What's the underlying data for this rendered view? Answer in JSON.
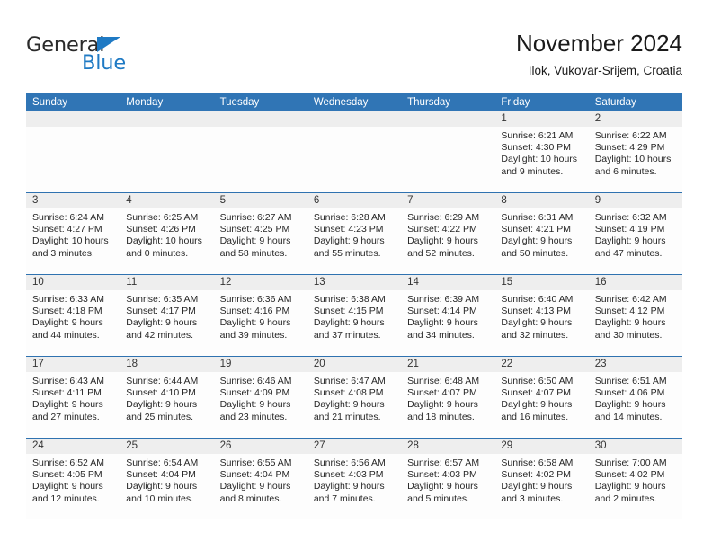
{
  "brand": {
    "word1": "General",
    "word2": "Blue",
    "triangle_color": "#1f7ac4",
    "text_color": "#2b2b2b"
  },
  "header": {
    "title": "November 2024",
    "subtitle": "Ilok, Vukovar-Srijem, Croatia"
  },
  "colors": {
    "header_blue": "#3075b5",
    "row_divider_blue": "#2f72b0",
    "daynum_band": "#eeeeee",
    "cell_background": "#fdfdfd",
    "text": "#262626"
  },
  "weekdays": [
    "Sunday",
    "Monday",
    "Tuesday",
    "Wednesday",
    "Thursday",
    "Friday",
    "Saturday"
  ],
  "weeks": [
    {
      "days": [
        {
          "day": "",
          "empty": true,
          "sunrise": "",
          "sunset": "",
          "daylight_l1": "",
          "daylight_l2": ""
        },
        {
          "day": "",
          "empty": true,
          "sunrise": "",
          "sunset": "",
          "daylight_l1": "",
          "daylight_l2": ""
        },
        {
          "day": "",
          "empty": true,
          "sunrise": "",
          "sunset": "",
          "daylight_l1": "",
          "daylight_l2": ""
        },
        {
          "day": "",
          "empty": true,
          "sunrise": "",
          "sunset": "",
          "daylight_l1": "",
          "daylight_l2": ""
        },
        {
          "day": "",
          "empty": true,
          "sunrise": "",
          "sunset": "",
          "daylight_l1": "",
          "daylight_l2": ""
        },
        {
          "day": "1",
          "empty": false,
          "sunrise": "Sunrise: 6:21 AM",
          "sunset": "Sunset: 4:30 PM",
          "daylight_l1": "Daylight: 10 hours",
          "daylight_l2": "and 9 minutes."
        },
        {
          "day": "2",
          "empty": false,
          "sunrise": "Sunrise: 6:22 AM",
          "sunset": "Sunset: 4:29 PM",
          "daylight_l1": "Daylight: 10 hours",
          "daylight_l2": "and 6 minutes."
        }
      ]
    },
    {
      "days": [
        {
          "day": "3",
          "empty": false,
          "sunrise": "Sunrise: 6:24 AM",
          "sunset": "Sunset: 4:27 PM",
          "daylight_l1": "Daylight: 10 hours",
          "daylight_l2": "and 3 minutes."
        },
        {
          "day": "4",
          "empty": false,
          "sunrise": "Sunrise: 6:25 AM",
          "sunset": "Sunset: 4:26 PM",
          "daylight_l1": "Daylight: 10 hours",
          "daylight_l2": "and 0 minutes."
        },
        {
          "day": "5",
          "empty": false,
          "sunrise": "Sunrise: 6:27 AM",
          "sunset": "Sunset: 4:25 PM",
          "daylight_l1": "Daylight: 9 hours",
          "daylight_l2": "and 58 minutes."
        },
        {
          "day": "6",
          "empty": false,
          "sunrise": "Sunrise: 6:28 AM",
          "sunset": "Sunset: 4:23 PM",
          "daylight_l1": "Daylight: 9 hours",
          "daylight_l2": "and 55 minutes."
        },
        {
          "day": "7",
          "empty": false,
          "sunrise": "Sunrise: 6:29 AM",
          "sunset": "Sunset: 4:22 PM",
          "daylight_l1": "Daylight: 9 hours",
          "daylight_l2": "and 52 minutes."
        },
        {
          "day": "8",
          "empty": false,
          "sunrise": "Sunrise: 6:31 AM",
          "sunset": "Sunset: 4:21 PM",
          "daylight_l1": "Daylight: 9 hours",
          "daylight_l2": "and 50 minutes."
        },
        {
          "day": "9",
          "empty": false,
          "sunrise": "Sunrise: 6:32 AM",
          "sunset": "Sunset: 4:19 PM",
          "daylight_l1": "Daylight: 9 hours",
          "daylight_l2": "and 47 minutes."
        }
      ]
    },
    {
      "days": [
        {
          "day": "10",
          "empty": false,
          "sunrise": "Sunrise: 6:33 AM",
          "sunset": "Sunset: 4:18 PM",
          "daylight_l1": "Daylight: 9 hours",
          "daylight_l2": "and 44 minutes."
        },
        {
          "day": "11",
          "empty": false,
          "sunrise": "Sunrise: 6:35 AM",
          "sunset": "Sunset: 4:17 PM",
          "daylight_l1": "Daylight: 9 hours",
          "daylight_l2": "and 42 minutes."
        },
        {
          "day": "12",
          "empty": false,
          "sunrise": "Sunrise: 6:36 AM",
          "sunset": "Sunset: 4:16 PM",
          "daylight_l1": "Daylight: 9 hours",
          "daylight_l2": "and 39 minutes."
        },
        {
          "day": "13",
          "empty": false,
          "sunrise": "Sunrise: 6:38 AM",
          "sunset": "Sunset: 4:15 PM",
          "daylight_l1": "Daylight: 9 hours",
          "daylight_l2": "and 37 minutes."
        },
        {
          "day": "14",
          "empty": false,
          "sunrise": "Sunrise: 6:39 AM",
          "sunset": "Sunset: 4:14 PM",
          "daylight_l1": "Daylight: 9 hours",
          "daylight_l2": "and 34 minutes."
        },
        {
          "day": "15",
          "empty": false,
          "sunrise": "Sunrise: 6:40 AM",
          "sunset": "Sunset: 4:13 PM",
          "daylight_l1": "Daylight: 9 hours",
          "daylight_l2": "and 32 minutes."
        },
        {
          "day": "16",
          "empty": false,
          "sunrise": "Sunrise: 6:42 AM",
          "sunset": "Sunset: 4:12 PM",
          "daylight_l1": "Daylight: 9 hours",
          "daylight_l2": "and 30 minutes."
        }
      ]
    },
    {
      "days": [
        {
          "day": "17",
          "empty": false,
          "sunrise": "Sunrise: 6:43 AM",
          "sunset": "Sunset: 4:11 PM",
          "daylight_l1": "Daylight: 9 hours",
          "daylight_l2": "and 27 minutes."
        },
        {
          "day": "18",
          "empty": false,
          "sunrise": "Sunrise: 6:44 AM",
          "sunset": "Sunset: 4:10 PM",
          "daylight_l1": "Daylight: 9 hours",
          "daylight_l2": "and 25 minutes."
        },
        {
          "day": "19",
          "empty": false,
          "sunrise": "Sunrise: 6:46 AM",
          "sunset": "Sunset: 4:09 PM",
          "daylight_l1": "Daylight: 9 hours",
          "daylight_l2": "and 23 minutes."
        },
        {
          "day": "20",
          "empty": false,
          "sunrise": "Sunrise: 6:47 AM",
          "sunset": "Sunset: 4:08 PM",
          "daylight_l1": "Daylight: 9 hours",
          "daylight_l2": "and 21 minutes."
        },
        {
          "day": "21",
          "empty": false,
          "sunrise": "Sunrise: 6:48 AM",
          "sunset": "Sunset: 4:07 PM",
          "daylight_l1": "Daylight: 9 hours",
          "daylight_l2": "and 18 minutes."
        },
        {
          "day": "22",
          "empty": false,
          "sunrise": "Sunrise: 6:50 AM",
          "sunset": "Sunset: 4:07 PM",
          "daylight_l1": "Daylight: 9 hours",
          "daylight_l2": "and 16 minutes."
        },
        {
          "day": "23",
          "empty": false,
          "sunrise": "Sunrise: 6:51 AM",
          "sunset": "Sunset: 4:06 PM",
          "daylight_l1": "Daylight: 9 hours",
          "daylight_l2": "and 14 minutes."
        }
      ]
    },
    {
      "days": [
        {
          "day": "24",
          "empty": false,
          "sunrise": "Sunrise: 6:52 AM",
          "sunset": "Sunset: 4:05 PM",
          "daylight_l1": "Daylight: 9 hours",
          "daylight_l2": "and 12 minutes."
        },
        {
          "day": "25",
          "empty": false,
          "sunrise": "Sunrise: 6:54 AM",
          "sunset": "Sunset: 4:04 PM",
          "daylight_l1": "Daylight: 9 hours",
          "daylight_l2": "and 10 minutes."
        },
        {
          "day": "26",
          "empty": false,
          "sunrise": "Sunrise: 6:55 AM",
          "sunset": "Sunset: 4:04 PM",
          "daylight_l1": "Daylight: 9 hours",
          "daylight_l2": "and 8 minutes."
        },
        {
          "day": "27",
          "empty": false,
          "sunrise": "Sunrise: 6:56 AM",
          "sunset": "Sunset: 4:03 PM",
          "daylight_l1": "Daylight: 9 hours",
          "daylight_l2": "and 7 minutes."
        },
        {
          "day": "28",
          "empty": false,
          "sunrise": "Sunrise: 6:57 AM",
          "sunset": "Sunset: 4:03 PM",
          "daylight_l1": "Daylight: 9 hours",
          "daylight_l2": "and 5 minutes."
        },
        {
          "day": "29",
          "empty": false,
          "sunrise": "Sunrise: 6:58 AM",
          "sunset": "Sunset: 4:02 PM",
          "daylight_l1": "Daylight: 9 hours",
          "daylight_l2": "and 3 minutes."
        },
        {
          "day": "30",
          "empty": false,
          "sunrise": "Sunrise: 7:00 AM",
          "sunset": "Sunset: 4:02 PM",
          "daylight_l1": "Daylight: 9 hours",
          "daylight_l2": "and 2 minutes."
        }
      ]
    }
  ]
}
